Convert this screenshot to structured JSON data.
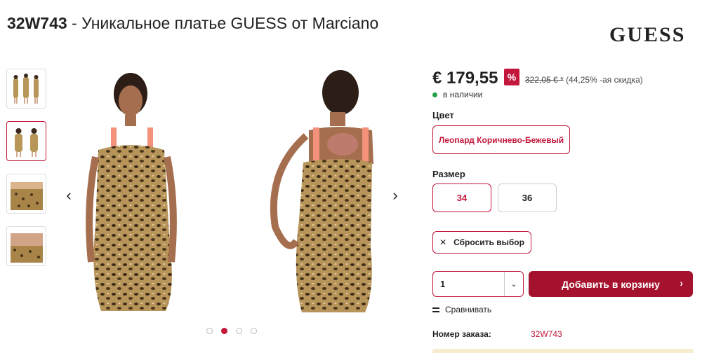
{
  "product": {
    "sku": "32W743",
    "title_rest": " - Уникальное платье GUESS от Marciano",
    "brand": "GUESS"
  },
  "gallery": {
    "thumb_count": 4,
    "active_index": 1,
    "dot_count": 4,
    "active_dot": 1
  },
  "pricing": {
    "price": "€ 179,55",
    "discount_badge": "%",
    "old_price": "322,05 € *",
    "discount_text": "(44,25% -ая скидка)",
    "availability": "в наличии"
  },
  "options": {
    "color_label": "Цвет",
    "color_value": "Леопард Коричнево-Бежевый",
    "size_label": "Размер",
    "sizes": [
      "34",
      "36"
    ],
    "selected_size": "34",
    "reset_label": "Сбросить выбор",
    "reset_icon": "✕"
  },
  "purchase": {
    "quantity": "1",
    "add_to_cart": "Добавить в корзину",
    "compare": "Сравнивать"
  },
  "order": {
    "label": "Номер заказа:",
    "value": "32W743"
  },
  "colors": {
    "accent": "#c2163a",
    "cart_button": "#a5122d",
    "in_stock": "#22a04a"
  }
}
